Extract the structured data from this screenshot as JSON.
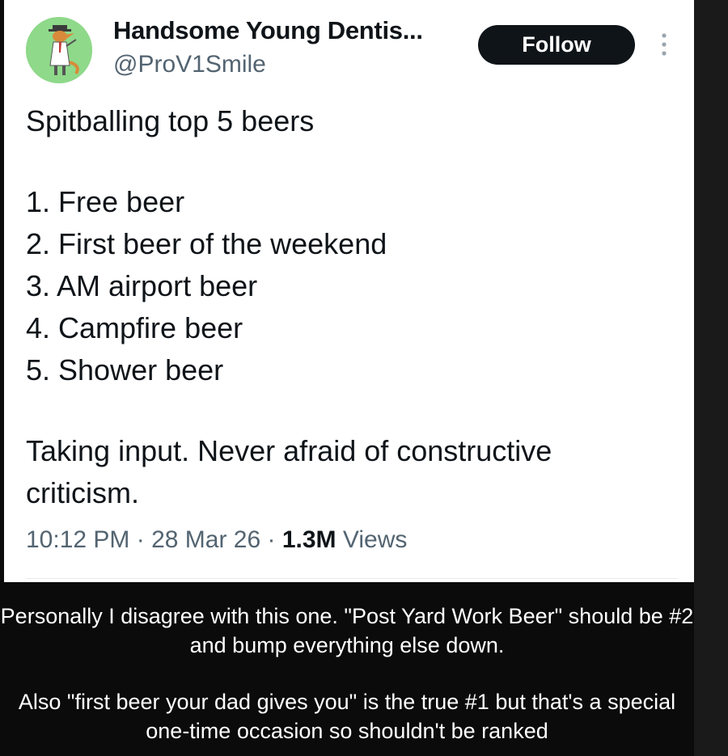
{
  "tweet": {
    "author": {
      "display_name": "Handsome Young Dentis...",
      "handle": "@ProV1Smile",
      "avatar_icon": "cartoon-avatar-icon",
      "avatar_bg": "#8fd98a"
    },
    "follow_label": "Follow",
    "more_icon": "more-vertical-icon",
    "body": {
      "intro": "Spitballing top 5 beers",
      "list": [
        "1. Free beer",
        "2. First beer of the weekend",
        "3. AM airport beer",
        "4. Campfire beer",
        "5. Shower beer"
      ],
      "closing": "Taking input. Never afraid of constructive criticism."
    },
    "meta": {
      "time": "10:12 PM",
      "separator": " · ",
      "date": "28 Mar 26",
      "views_count": "1.3M",
      "views_label": " Views"
    }
  },
  "caption": {
    "paragraphs": [
      "Personally I disagree with this one. \"Post Yard Work Beer\" should be #2 and bump everything else down.",
      "Also \"first beer your dad gives you\" is the true #1 but that's a special one-time occasion so shouldn't be ranked"
    ]
  },
  "colors": {
    "card_bg": "#ffffff",
    "page_bg": "#0b0b0b",
    "text_primary": "#0f1419",
    "text_secondary": "#536471",
    "button_bg": "#0f1419"
  }
}
